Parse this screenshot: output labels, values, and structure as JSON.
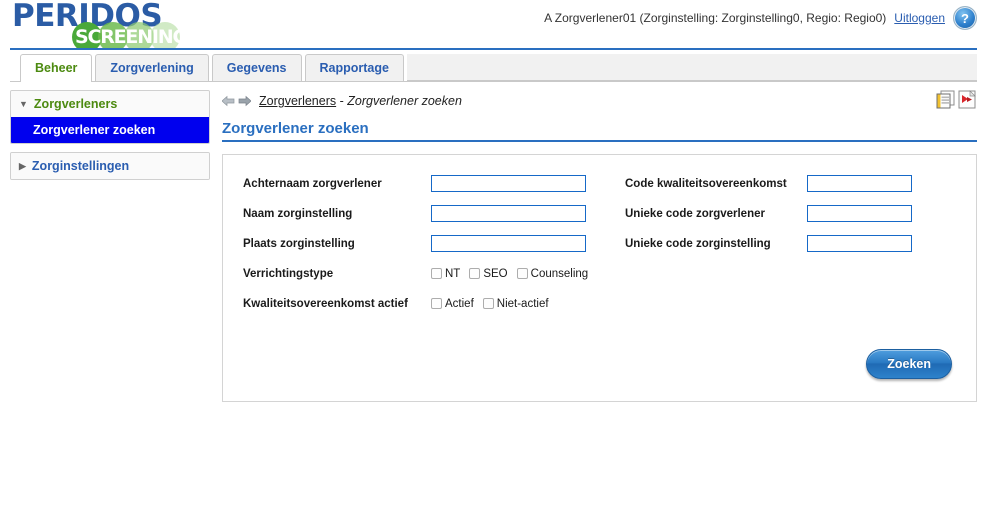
{
  "brand": {
    "name": "PERIDOS",
    "sub": "SCREENING"
  },
  "header": {
    "user_info": "A Zorgverlener01 (Zorginstelling: Zorginstelling0, Regio: Regio0)",
    "logout_label": "Uitloggen",
    "help_glyph": "?"
  },
  "tabs": [
    {
      "label": "Beheer",
      "active": true
    },
    {
      "label": "Zorgverlening",
      "active": false
    },
    {
      "label": "Gegevens",
      "active": false
    },
    {
      "label": "Rapportage",
      "active": false
    }
  ],
  "sidebar": {
    "groups": [
      {
        "label": "Zorgverleners",
        "caret": "▼",
        "items": [
          {
            "label": "Zorgverlener zoeken",
            "selected": true
          }
        ]
      },
      {
        "label": "Zorginstellingen",
        "caret": "▶",
        "items": []
      }
    ]
  },
  "breadcrumb": {
    "link": "Zorgverleners",
    "separator": "-",
    "current": "Zorgverlener zoeken"
  },
  "page": {
    "title": "Zorgverlener zoeken"
  },
  "form": {
    "left": [
      {
        "label": "Achternaam zorgverlener",
        "type": "text",
        "value": ""
      },
      {
        "label": "Naam zorginstelling",
        "type": "text",
        "value": ""
      },
      {
        "label": "Plaats zorginstelling",
        "type": "text",
        "value": ""
      },
      {
        "label": "Verrichtingstype",
        "type": "checkboxes",
        "options": [
          {
            "label": "NT",
            "checked": false
          },
          {
            "label": "SEO",
            "checked": false
          },
          {
            "label": "Counseling",
            "checked": false
          }
        ]
      },
      {
        "label": "Kwaliteitsovereenkomst actief",
        "type": "checkboxes",
        "options": [
          {
            "label": "Actief",
            "checked": false
          },
          {
            "label": "Niet-actief",
            "checked": false
          }
        ]
      }
    ],
    "right": [
      {
        "label": "Code kwaliteitsovereenkomst",
        "type": "text",
        "value": ""
      },
      {
        "label": "Unieke code zorgverlener",
        "type": "text",
        "value": ""
      },
      {
        "label": "Unieke code zorginstelling",
        "type": "text",
        "value": ""
      }
    ],
    "submit_label": "Zoeken"
  },
  "colors": {
    "brand_blue": "#2b5ca5",
    "accent_blue": "#2a6fc0",
    "active_tab_green": "#4c8a10",
    "selected_nav": "#0000ee"
  }
}
